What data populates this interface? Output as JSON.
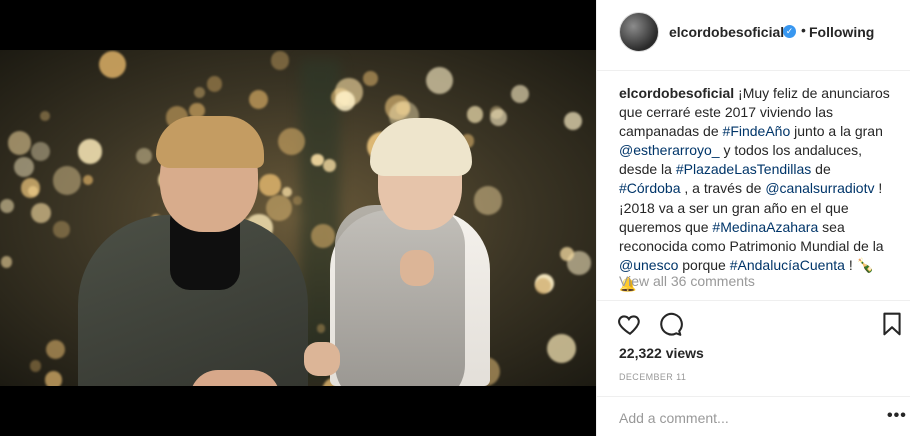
{
  "post": {
    "username": "elcordobesoficial",
    "verified_badge": "✓",
    "separator": "•",
    "follow_status": "Following",
    "caption": {
      "username": "elcordobesoficial",
      "parts": [
        {
          "type": "text",
          "value": " ¡Muy feliz de anunciaros que cerraré este 2017 viviendo las campanadas de "
        },
        {
          "type": "tag",
          "value": "#FindeAño"
        },
        {
          "type": "text",
          "value": " junto a la gran "
        },
        {
          "type": "tag",
          "value": "@estherarroyo_"
        },
        {
          "type": "text",
          "value": " y todos los andaluces, desde la "
        },
        {
          "type": "tag",
          "value": "#PlazadeLasTendillas"
        },
        {
          "type": "text",
          "value": " de "
        },
        {
          "type": "tag",
          "value": "#Córdoba"
        },
        {
          "type": "text",
          "value": " , a través de "
        },
        {
          "type": "tag",
          "value": "@canalsurradiotv"
        },
        {
          "type": "text",
          "value": " ! ¡2018 va a ser un gran año en el que queremos que "
        },
        {
          "type": "tag",
          "value": "#MedinaAzahara"
        },
        {
          "type": "text",
          "value": " sea reconocida como Patrimonio Mundial de la "
        },
        {
          "type": "tag",
          "value": "@unesco"
        },
        {
          "type": "text",
          "value": " porque "
        },
        {
          "type": "tag",
          "value": "#AndalucíaCuenta"
        },
        {
          "type": "text",
          "value": " ! 🍾🔔"
        }
      ]
    },
    "view_all_comments": "View all 36 comments",
    "views": "22,322 views",
    "date": "DECEMBER 11",
    "add_comment_placeholder": "Add a comment...",
    "more_options": "•••"
  },
  "icons": {
    "like": "heart-icon",
    "comment": "comment-icon",
    "save": "bookmark-icon"
  },
  "colors": {
    "link": "#003569",
    "verified": "#3897f0",
    "muted": "#999999",
    "text": "#262626"
  }
}
